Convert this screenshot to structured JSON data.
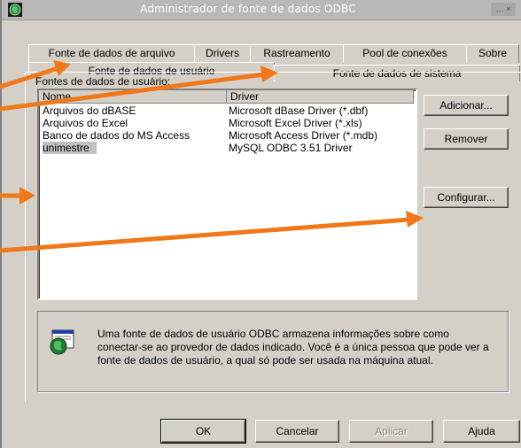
{
  "window": {
    "title": "Administrador de fonte de dados ODBC",
    "control_label": "… ×"
  },
  "tabs_back": [
    {
      "label": "Fonte de dados de arquivo"
    },
    {
      "label": "Drivers"
    },
    {
      "label": "Rastreamento"
    },
    {
      "label": "Pool de conexões"
    },
    {
      "label": "Sobre"
    }
  ],
  "tabs_front": [
    {
      "label": "Fonte de dados de usuário",
      "selected": true
    },
    {
      "label": "Fonte de dados de sistema",
      "selected": false
    }
  ],
  "group_label": "Fontes de dados de usuário:",
  "list": {
    "columns": [
      "Nome",
      "Driver"
    ],
    "rows": [
      {
        "name": "Arquivos do dBASE",
        "driver": "Microsoft dBase Driver (*.dbf)"
      },
      {
        "name": "Arquivos do Excel",
        "driver": "Microsoft Excel Driver (*.xls)"
      },
      {
        "name": "Banco de dados do MS Access",
        "driver": "Microsoft Access Driver (*.mdb)"
      },
      {
        "name": "unimestre",
        "driver": "MySQL ODBC 3.51 Driver",
        "selected": true
      }
    ]
  },
  "side_buttons": {
    "add": "Adicionar...",
    "remove": "Remover",
    "configure": "Configurar..."
  },
  "info_text": "Uma fonte de dados de usuário ODBC armazena informações sobre como conectar-se ao provedor de dados indicado. Você é a única pessoa que pode ver a fonte de dados de usuário, a qual só pode ser usada na máquina atual.",
  "bottom_buttons": {
    "ok": "OK",
    "cancel": "Cancelar",
    "apply": "Aplicar",
    "help": "Ajuda"
  },
  "colors": {
    "annotation_arrow": "#f07818",
    "dialog_face": "#d4d0c8",
    "selection": "#c0c0c0"
  },
  "icons": {
    "title": "odbc-globe-icon",
    "info": "odbc-datasource-icon",
    "annotation": "arrow-icon"
  }
}
